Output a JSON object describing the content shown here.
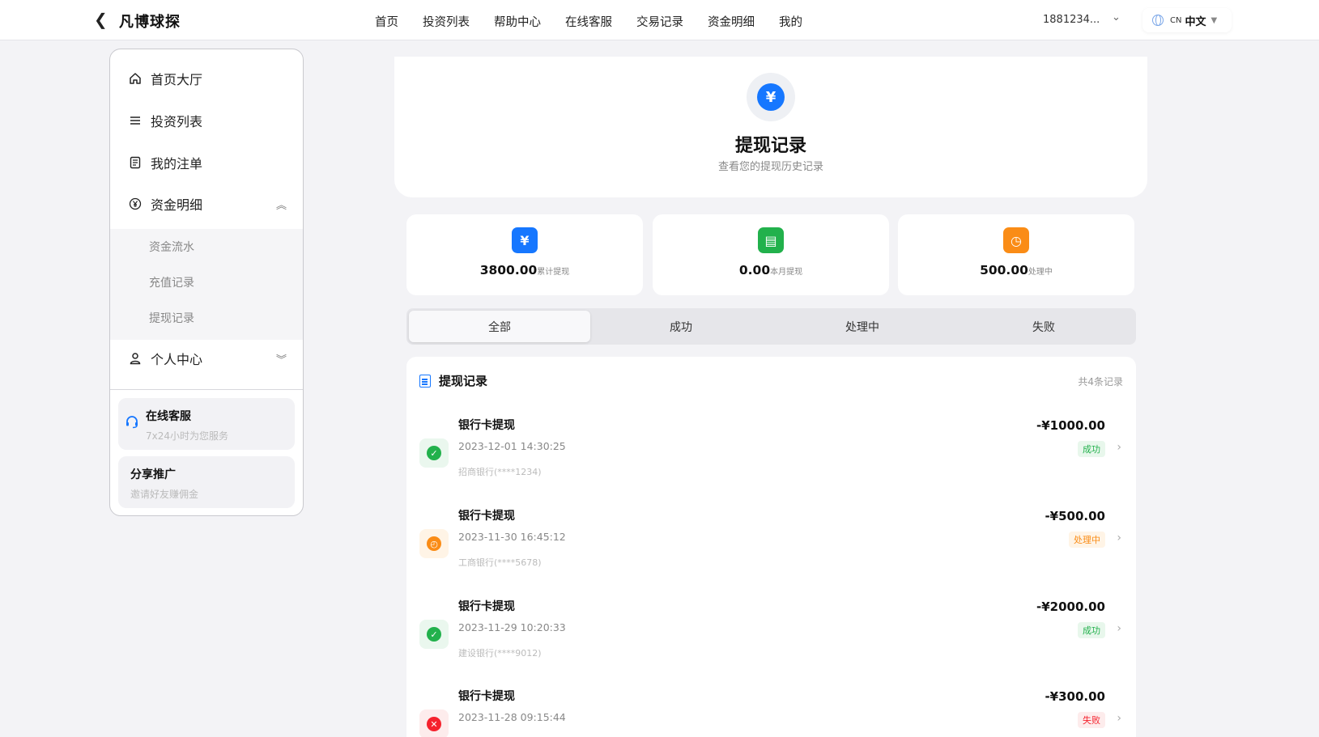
{
  "header": {
    "brand": "凡博球探",
    "nav": [
      "首页",
      "投资列表",
      "帮助中心",
      "在线客服",
      "交易记录",
      "资金明细",
      "我的"
    ],
    "user": "1881234...",
    "lang_code": "CN",
    "lang_label": "中文"
  },
  "sidebar": {
    "items": [
      {
        "label": "首页大厅",
        "icon": "home-icon"
      },
      {
        "label": "投资列表",
        "icon": "list-icon"
      },
      {
        "label": "我的注单",
        "icon": "document-icon"
      },
      {
        "label": "资金明细",
        "icon": "yuan-circle-icon"
      },
      {
        "label": "个人中心",
        "icon": "user-icon"
      }
    ],
    "submenu": [
      "资金流水",
      "充值记录",
      "提现记录"
    ],
    "service": {
      "title": "在线客服",
      "subtitle": "7x24小时为您服务"
    },
    "share": {
      "title": "分享推广",
      "subtitle": "邀请好友赚佣金"
    }
  },
  "hero": {
    "icon_glyph": "¥",
    "title": "提现记录",
    "subtitle": "查看您的提现历史记录"
  },
  "stats": [
    {
      "value": "3800.00",
      "label": "累计提现",
      "color": "#1677ff",
      "glyph": "¥",
      "icon": "yuan-icon"
    },
    {
      "value": "0.00",
      "label": "本月提现",
      "color": "#22b14c",
      "glyph": "▤",
      "icon": "calendar-icon"
    },
    {
      "value": "500.00",
      "label": "处理中",
      "color": "#fa8c16",
      "glyph": "◷",
      "icon": "clock-icon"
    }
  ],
  "tabs": [
    "全部",
    "成功",
    "处理中",
    "失败"
  ],
  "records": {
    "title": "提现记录",
    "count": "共4条记录",
    "items": [
      {
        "title": "银行卡提现",
        "date": "2023-12-01 14:30:25",
        "bank": "招商银行(****1234)",
        "amount": "-¥1000.00",
        "status": "成功",
        "kind": "success"
      },
      {
        "title": "银行卡提现",
        "date": "2023-11-30 16:45:12",
        "bank": "工商银行(****5678)",
        "amount": "-¥500.00",
        "status": "处理中",
        "kind": "pending"
      },
      {
        "title": "银行卡提现",
        "date": "2023-11-29 10:20:33",
        "bank": "建设银行(****9012)",
        "amount": "-¥2000.00",
        "status": "成功",
        "kind": "success"
      },
      {
        "title": "银行卡提现",
        "date": "2023-11-28 09:15:44",
        "bank": "",
        "amount": "-¥300.00",
        "status": "失败",
        "kind": "failed"
      }
    ]
  }
}
